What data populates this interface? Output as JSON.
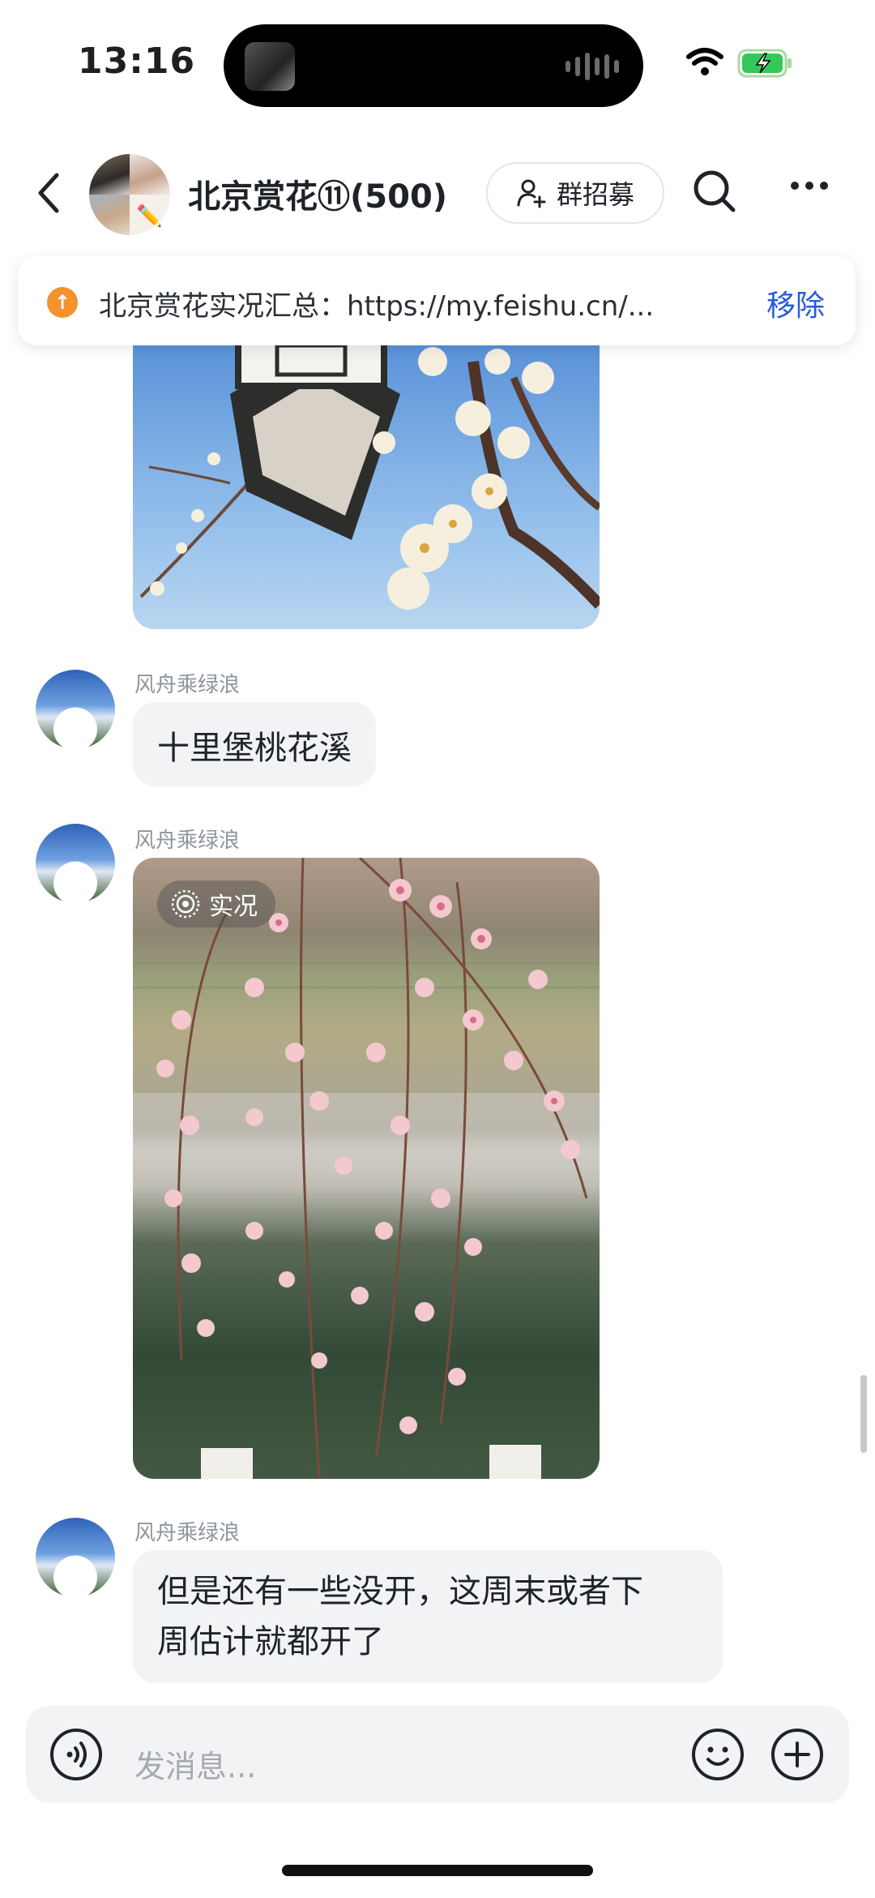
{
  "status_bar": {
    "time": "13:16"
  },
  "header": {
    "back_icon": "chevron-left-icon",
    "title": "北京赏花⑪(500)",
    "recruit_label": "群招募",
    "search_icon": "search-icon",
    "more_icon": "more-horizontal-icon"
  },
  "pinned": {
    "text": "北京赏花实况汇总：https://my.feishu.cn/...",
    "action_label": "移除",
    "accent_color": "#f4922b",
    "action_color": "#245bdb"
  },
  "messages": [
    {
      "type": "image",
      "description_icon": "lamp-plum-blossom-photo"
    },
    {
      "type": "text",
      "sender": "风舟乘绿浪",
      "text": "十里堡桃花溪"
    },
    {
      "type": "image",
      "sender": "风舟乘绿浪",
      "badge": "实况"
    },
    {
      "type": "text",
      "sender": "风舟乘绿浪",
      "text_line1": "但是还有一些没开，这周末或者下",
      "text_line2": "周估计就都开了"
    }
  ],
  "input": {
    "placeholder": "发消息...",
    "voice_icon": "voice-icon",
    "emoji_icon": "emoji-icon",
    "plus_icon": "plus-icon"
  }
}
